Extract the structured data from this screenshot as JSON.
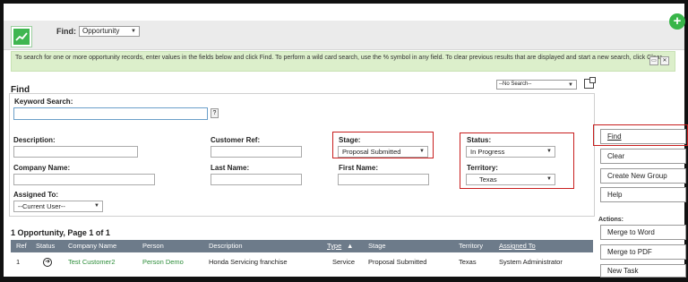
{
  "header": {
    "find_label": "Find:",
    "find_select": "Opportunity",
    "plus": "+"
  },
  "info": {
    "text": "To search for one or more opportunity records, enter values in the fields below and click Find. To perform a wild card search, use the % symbol in any field. To clear previous results that are displayed and start a new search, click Clear."
  },
  "find": {
    "title": "Find",
    "saved_search": "--No Search--",
    "keyword_label": "Keyword Search:",
    "keyword_value": "",
    "help_q": "?",
    "description_label": "Description:",
    "customer_ref_label": "Customer Ref:",
    "stage_label": "Stage:",
    "stage_value": "Proposal Submitted",
    "status_label": "Status:",
    "status_value": "In Progress",
    "company_label": "Company Name:",
    "lastname_label": "Last Name:",
    "firstname_label": "First Name:",
    "territory_label": "Territory:",
    "territory_value": "Texas",
    "assigned_label": "Assigned To:",
    "assigned_value": "--Current User--"
  },
  "side": {
    "find": "Find",
    "clear": "Clear",
    "create_group": "Create New Group",
    "help": "Help",
    "actions_label": "Actions:",
    "merge_word": "Merge to Word",
    "merge_pdf": "Merge to PDF",
    "new_task": "New Task"
  },
  "results": {
    "title": "1 Opportunity, Page 1 of 1",
    "columns": [
      "Ref",
      "Status",
      "Company Name",
      "Person",
      "Description",
      "Type",
      "Stage",
      "Territory",
      "Assigned To"
    ],
    "rows": [
      [
        "1",
        "",
        "Test Customer2",
        "Person Demo",
        "Honda Servicing franchise",
        "Service",
        "Proposal Submitted",
        "Texas",
        "System Administrator"
      ]
    ]
  }
}
